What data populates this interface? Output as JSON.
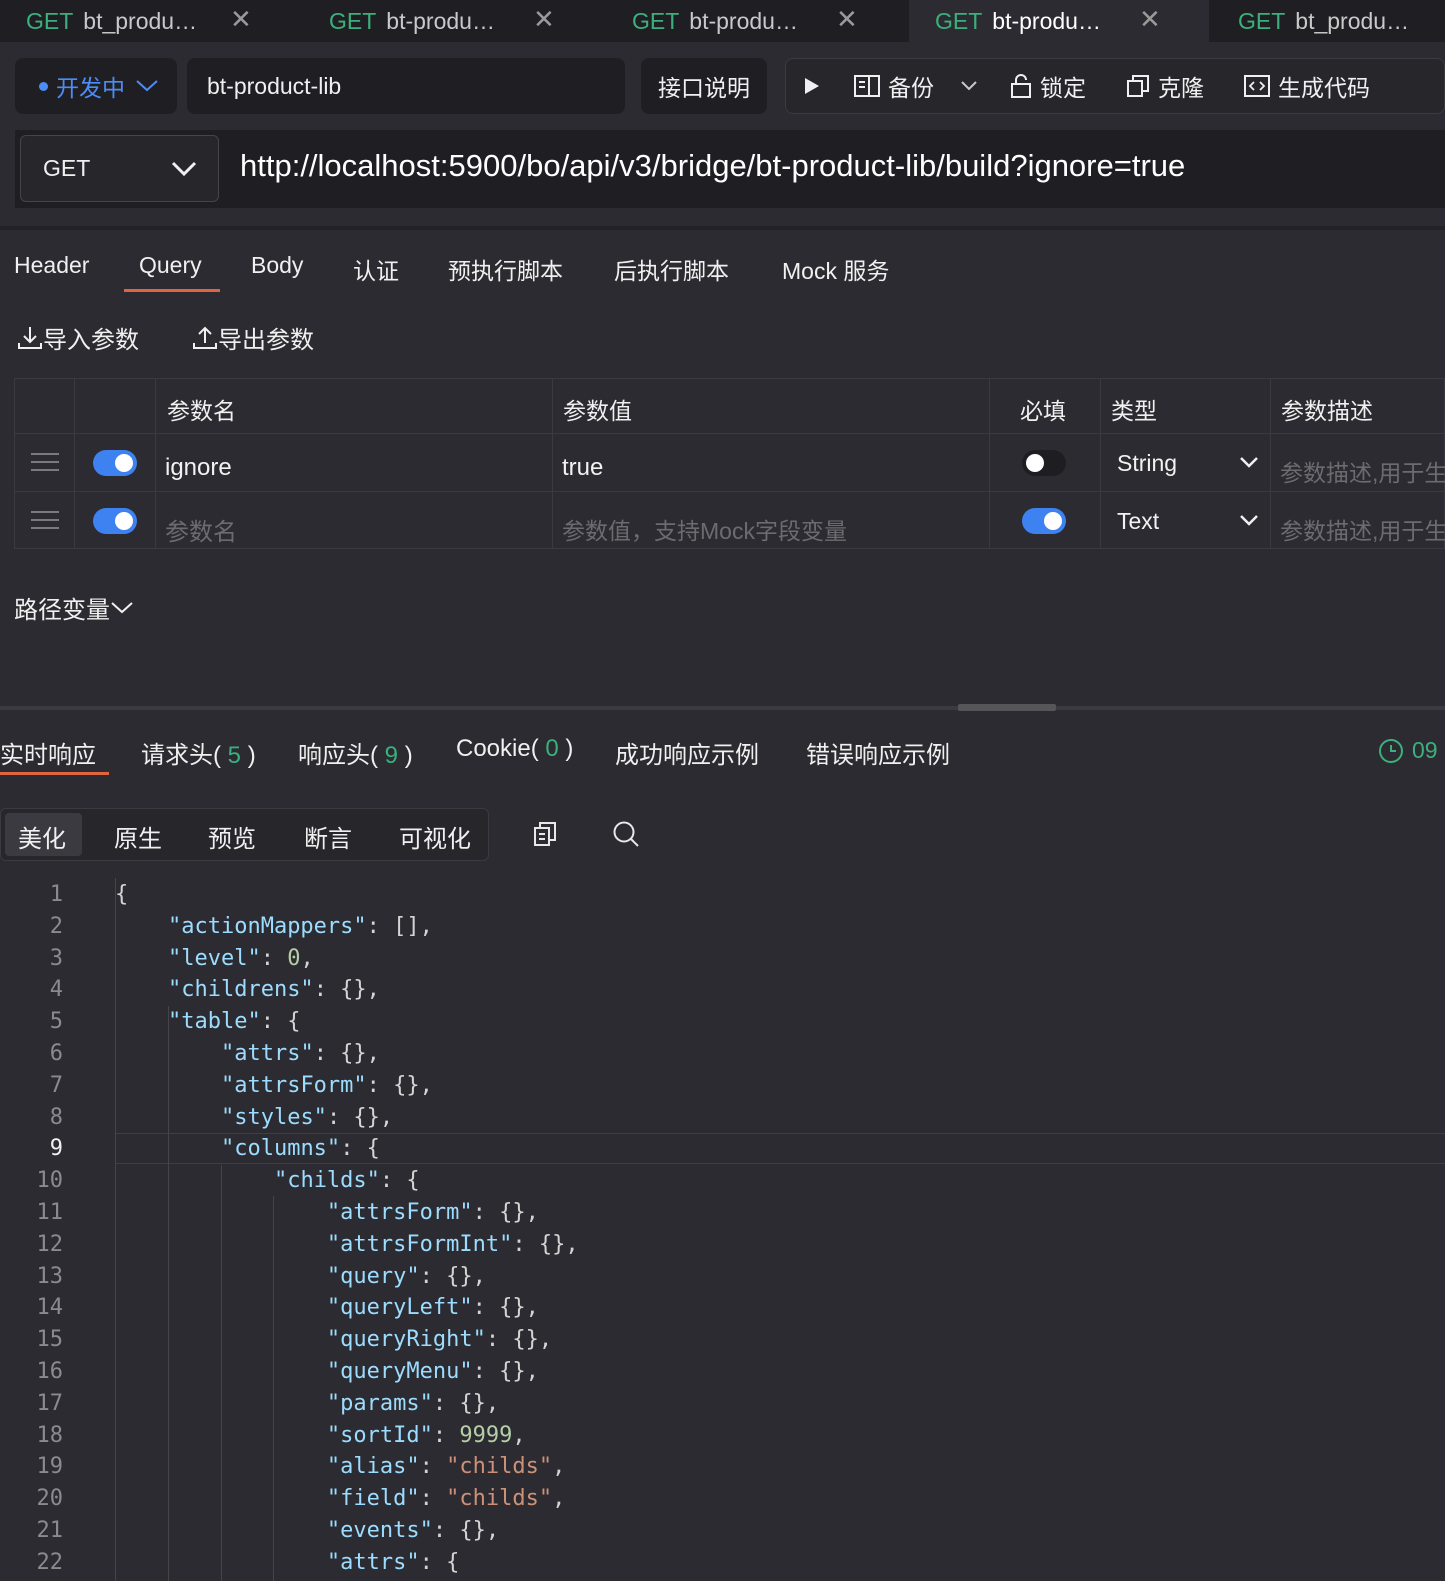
{
  "tabs": [
    {
      "method": "GET",
      "title": "bt_produ…",
      "close": "✕"
    },
    {
      "method": "GET",
      "title": "bt-produ…",
      "close": "✕"
    },
    {
      "method": "GET",
      "title": "bt-produ…",
      "close": "✕"
    },
    {
      "method": "GET",
      "title": "bt-produ…",
      "close": "✕"
    },
    {
      "method": "GET",
      "title": "bt_produ…",
      "close": ""
    }
  ],
  "toolbar": {
    "env": "开发中",
    "name": "bt-product-lib",
    "doc": "接口说明",
    "backup": "备份",
    "lock": "锁定",
    "clone": "克隆",
    "codegen": "生成代码"
  },
  "request": {
    "method": "GET",
    "url": "http://localhost:5900/bo/api/v3/bridge/bt-product-lib/build?ignore=true"
  },
  "request_tabs": [
    "Header",
    "Query",
    "Body",
    "认证",
    "预执行脚本",
    "后执行脚本",
    "Mock 服务"
  ],
  "active_request_tab": "Query",
  "params_tools": {
    "import": "导入参数",
    "export": "导出参数"
  },
  "params_table": {
    "headers": [
      "参数名",
      "参数值",
      "必填",
      "类型",
      "参数描述"
    ],
    "rows": [
      {
        "enabled": true,
        "name": "ignore",
        "value": "true",
        "required": false,
        "type": "String",
        "desc_placeholder": "参数描述,用于生"
      },
      {
        "enabled": true,
        "name_placeholder": "参数名",
        "value_placeholder": "参数值，支持Mock字段变量",
        "required": true,
        "type": "Text",
        "desc_placeholder": "参数描述,用于生"
      }
    ]
  },
  "path_var": "路径变量",
  "response_tabs": [
    {
      "label": "实时响应"
    },
    {
      "label": "请求头(",
      "count": "5",
      "end": ")"
    },
    {
      "label": "响应头(",
      "count": "9",
      "end": ")"
    },
    {
      "label": "Cookie(",
      "count": "0",
      "end": ")"
    },
    {
      "label": "成功响应示例"
    },
    {
      "label": "错误响应示例"
    }
  ],
  "response_time": "09",
  "view_modes": [
    "美化",
    "原生",
    "预览",
    "断言",
    "可视化"
  ],
  "active_view_mode": "美化",
  "code_lines": [
    {
      "n": "1",
      "text": "{"
    },
    {
      "n": "2",
      "text": "    \"actionMappers\": [],"
    },
    {
      "n": "3",
      "text": "    \"level\": 0,"
    },
    {
      "n": "4",
      "text": "    \"childrens\": {},"
    },
    {
      "n": "5",
      "text": "    \"table\": {"
    },
    {
      "n": "6",
      "text": "        \"attrs\": {},"
    },
    {
      "n": "7",
      "text": "        \"attrsForm\": {},"
    },
    {
      "n": "8",
      "text": "        \"styles\": {},"
    },
    {
      "n": "9",
      "text": "        \"columns\": {"
    },
    {
      "n": "10",
      "text": "            \"childs\": {"
    },
    {
      "n": "11",
      "text": "                \"attrsForm\": {},"
    },
    {
      "n": "12",
      "text": "                \"attrsFormInt\": {},"
    },
    {
      "n": "13",
      "text": "                \"query\": {},"
    },
    {
      "n": "14",
      "text": "                \"queryLeft\": {},"
    },
    {
      "n": "15",
      "text": "                \"queryRight\": {},"
    },
    {
      "n": "16",
      "text": "                \"queryMenu\": {},"
    },
    {
      "n": "17",
      "text": "                \"params\": {},"
    },
    {
      "n": "18",
      "text": "                \"sortId\": 9999,"
    },
    {
      "n": "19",
      "text": "                \"alias\": \"childs\","
    },
    {
      "n": "20",
      "text": "                \"field\": \"childs\","
    },
    {
      "n": "21",
      "text": "                \"events\": {},"
    },
    {
      "n": "22",
      "text": "                \"attrs\": {"
    }
  ],
  "current_line": "9",
  "colors": {
    "accent": "#e0643e",
    "green": "#3bb07c",
    "blue": "#3d82f0"
  }
}
